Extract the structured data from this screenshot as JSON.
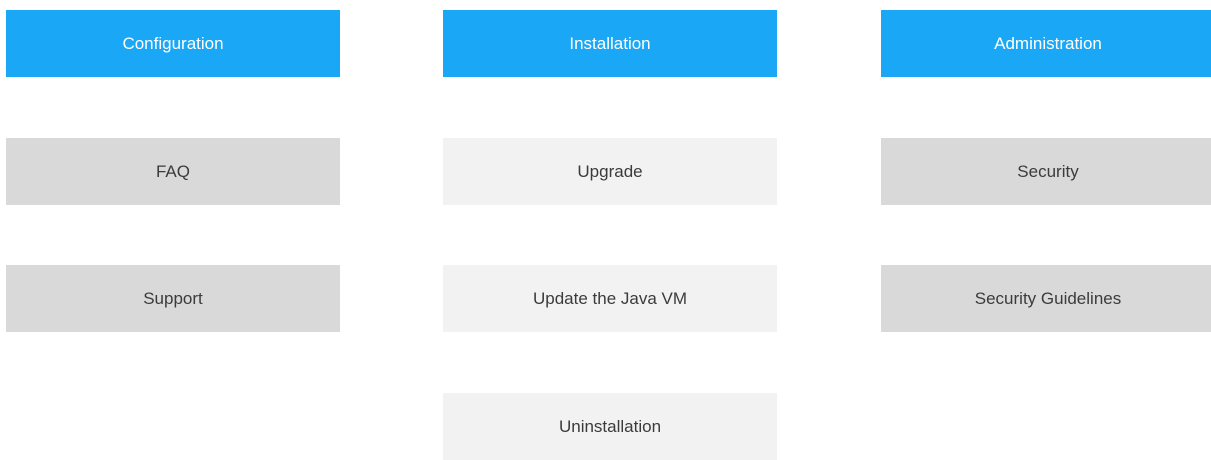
{
  "tiles": {
    "configuration": "Configuration",
    "installation": "Installation",
    "administration": "Administration",
    "faq": "FAQ",
    "upgrade": "Upgrade",
    "security": "Security",
    "support": "Support",
    "update_java_vm": "Update the Java VM",
    "security_guidelines": "Security Guidelines",
    "uninstallation": "Uninstallation"
  },
  "colors": {
    "primary": "#1aa7f5",
    "gray": "#d9d9d9",
    "light": "#f2f2f2",
    "text": "#3b3b3b"
  }
}
